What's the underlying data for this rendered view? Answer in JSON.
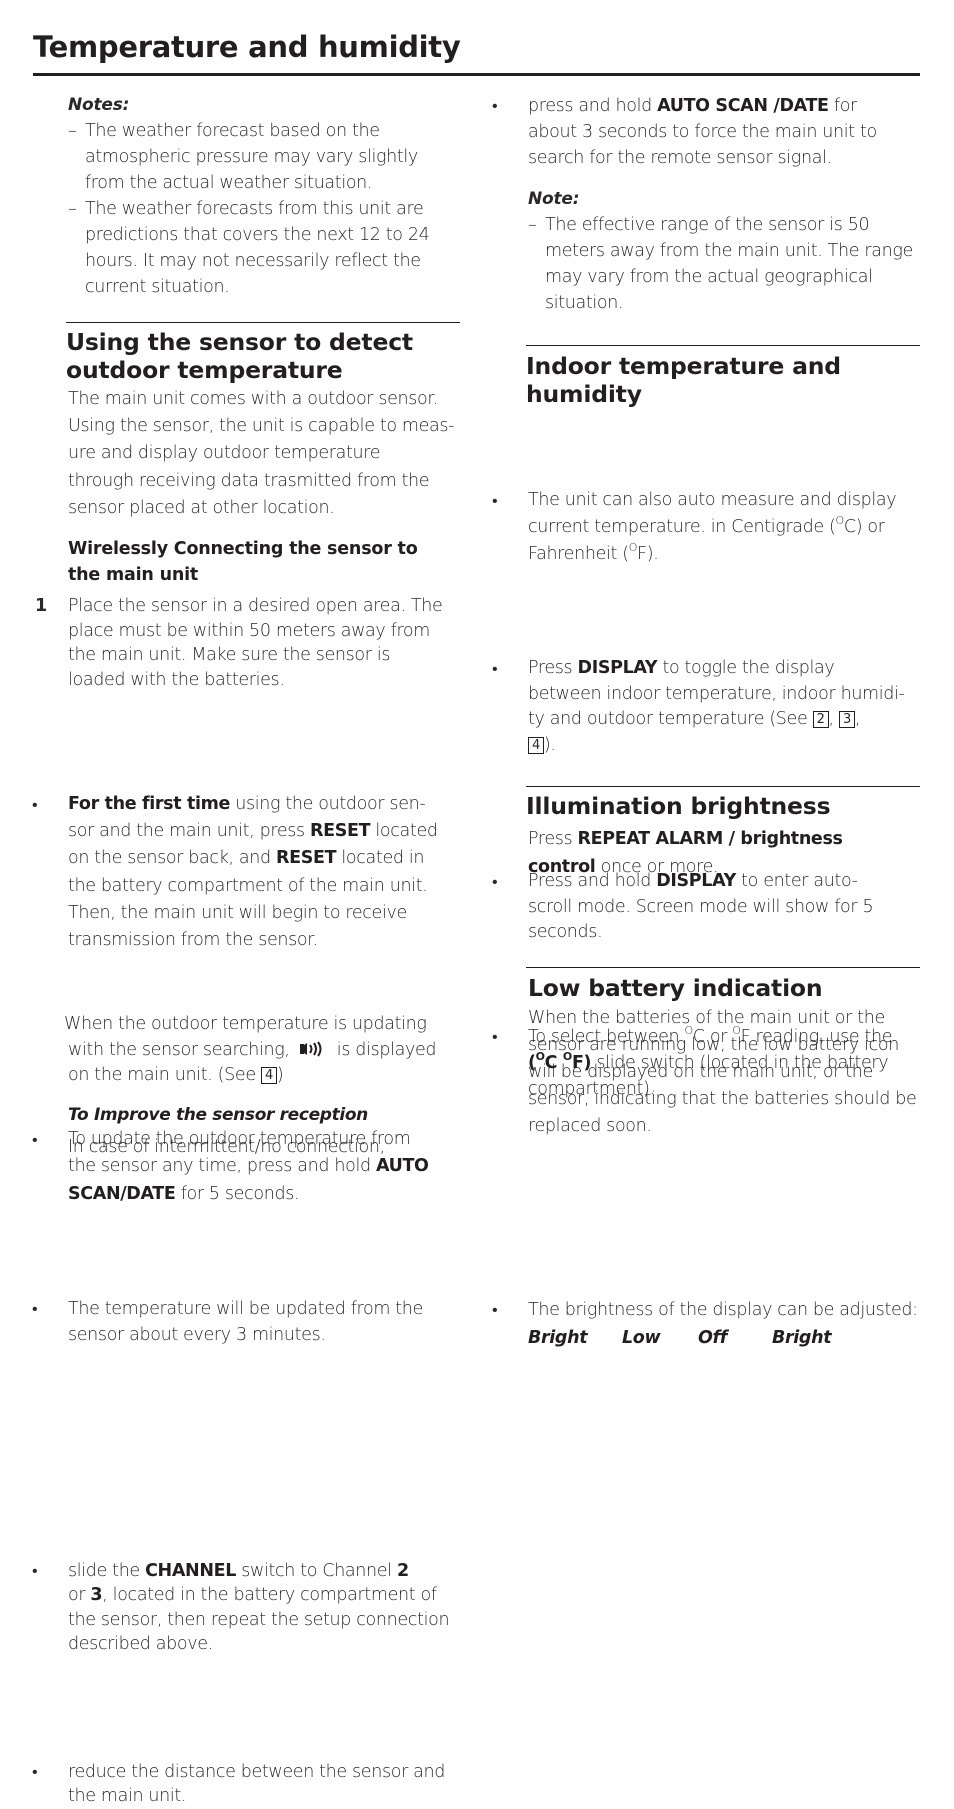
{
  "page": {
    "title": "Temperature and humidity"
  },
  "left": {
    "notes": {
      "label": "Notes:",
      "items": [
        [
          "The weather forecast based on the",
          "atmospheric pressure may vary slightly",
          "from the actual weather situation."
        ],
        [
          "The weather forecasts from this unit are",
          "predictions that covers the next 12 to 24",
          "hours. It may not necessarily reflect the",
          "current situation."
        ]
      ],
      "dash": "–"
    },
    "sensor_section": {
      "heading_line1": "Using the sensor to detect",
      "heading_line2": "outdoor temperature",
      "intro": [
        "The main unit comes with a outdoor sensor.",
        "Using the sensor, the unit is capable to meas-",
        "ure and display outdoor temperature",
        "through receiving data trasmitted from the",
        "sensor placed at other location."
      ],
      "subheading_line1": "Wirelessly Connecting the sensor to",
      "subheading_line2": "the main unit",
      "step_number": "1",
      "step_text": [
        "Place the sensor in a desired open area. The",
        "place must be within 50 meters away from",
        "the main unit.  Make sure the sensor is",
        "loaded with the batteries."
      ],
      "bullet": "•",
      "first_time": {
        "bold": "For the first time",
        "l1_rest": " using the outdoor sen-",
        "l2_pre": "sor and the main unit, press ",
        "l2_bold": "RESET",
        "l2_post": " located",
        "l3_pre": "on the sensor back, and ",
        "l3_bold": "RESET",
        "l3_post": " located in",
        "l4": "the battery compartment of the main unit.",
        "l5": "Then, the main unit will begin to receive",
        "l6": "transmission from the sensor."
      },
      "update": {
        "l1": "To update the outdoor temperature from",
        "l2_pre": "the sensor any time, press and hold ",
        "l2_bold": "AUTO",
        "l3_bold": "SCAN/DATE",
        "l3_post": " for 5 seconds."
      },
      "interval": {
        "l1": "The temperature will be updated from the",
        "l2": "sensor about every 3 minutes."
      },
      "searching": {
        "l1": "When the outdoor temperature is updating",
        "l2_pre": "with the sensor searching,",
        "l2_post": " is displayed",
        "l3_pre": "on the main unit. (See ",
        "l3_box": "4",
        "l3_post": ")"
      },
      "improve": {
        "heading": "To Improve the sensor reception",
        "intro": "In case of intermittent/no connection,",
        "channel": {
          "l1_pre": "slide the ",
          "l1_bold": "CHANNEL",
          "l1_mid": " switch to Channel ",
          "l1_bold2": "2",
          "l2_pre": "or ",
          "l2_bold": "3",
          "l2_post": ", located in the battery compartment of",
          "l3": "the sensor, then repeat the setup connection",
          "l4": "described above."
        },
        "distance": [
          "reduce the distance between the sensor and",
          "the main unit."
        ]
      }
    }
  },
  "right": {
    "force_search": {
      "l1_pre": "press and hold ",
      "l1_bold": "AUTO SCAN /DATE",
      "l1_post": " for",
      "l2": "about 3 seconds to force the main unit to",
      "l3": "search for the remote sensor signal."
    },
    "note": {
      "label": "Note:",
      "lines": [
        "The effective range of the sensor is 50",
        "meters away from the main unit. The range",
        "may vary from the actual geographical",
        "situation."
      ]
    },
    "indoor": {
      "heading_line1": "Indoor temperature and",
      "heading_line2": "humidity",
      "auto": {
        "l1": "The unit can also auto measure and display",
        "l2_pre": "current temperature. in Centigrade (",
        "deg": "O",
        "l2_post": "C) or",
        "l3_pre": "Fahrenheit (",
        "l3_post": "F)."
      },
      "display": {
        "l1_pre": "Press ",
        "l1_bold": "DISPLAY",
        "l1_post": " to toggle the display",
        "l2": "between indoor temperature, indoor humidi-",
        "l3_pre": "ty and outdoor temperature (See ",
        "box1": "2",
        "sep": ",  ",
        "box2": "3",
        "comma": ",",
        "box3": "4",
        "end": ")."
      },
      "autoscroll": {
        "l1_pre": "Press and hold ",
        "l1_bold": "DISPLAY",
        "l1_post": " to enter auto-",
        "l2": "scroll mode. Screen mode will show for 5",
        "l3": "seconds."
      },
      "unit_switch": {
        "l1_a": "To select between ",
        "l1_b": "C or ",
        "l1_c": "F reading, use the",
        "l2_bold_open": "(",
        "l2_bold_c": "C ",
        "l2_bold_f": "F)",
        "l2_post": " slide switch (located in the battery",
        "l3": "compartment)."
      }
    },
    "illumination": {
      "heading": "Illumination brightness",
      "l1_pre": "Press ",
      "l1_bold": "REPEAT ALARM / brightness",
      "l2_bold": "control",
      "l2_post": " once or more.",
      "bullet_text": "The brightness of the display can be adjusted:",
      "levels": [
        "Bright",
        "Low",
        "Off",
        "Bright"
      ]
    },
    "battery": {
      "heading": "Low battery indication",
      "lines": [
        "When the batteries of the main unit or the",
        "sensor are running low, the low battery icon",
        "will be displayed on the main unit, or the",
        "sensor, indicating that the batteries should be",
        "replaced soon."
      ]
    }
  }
}
